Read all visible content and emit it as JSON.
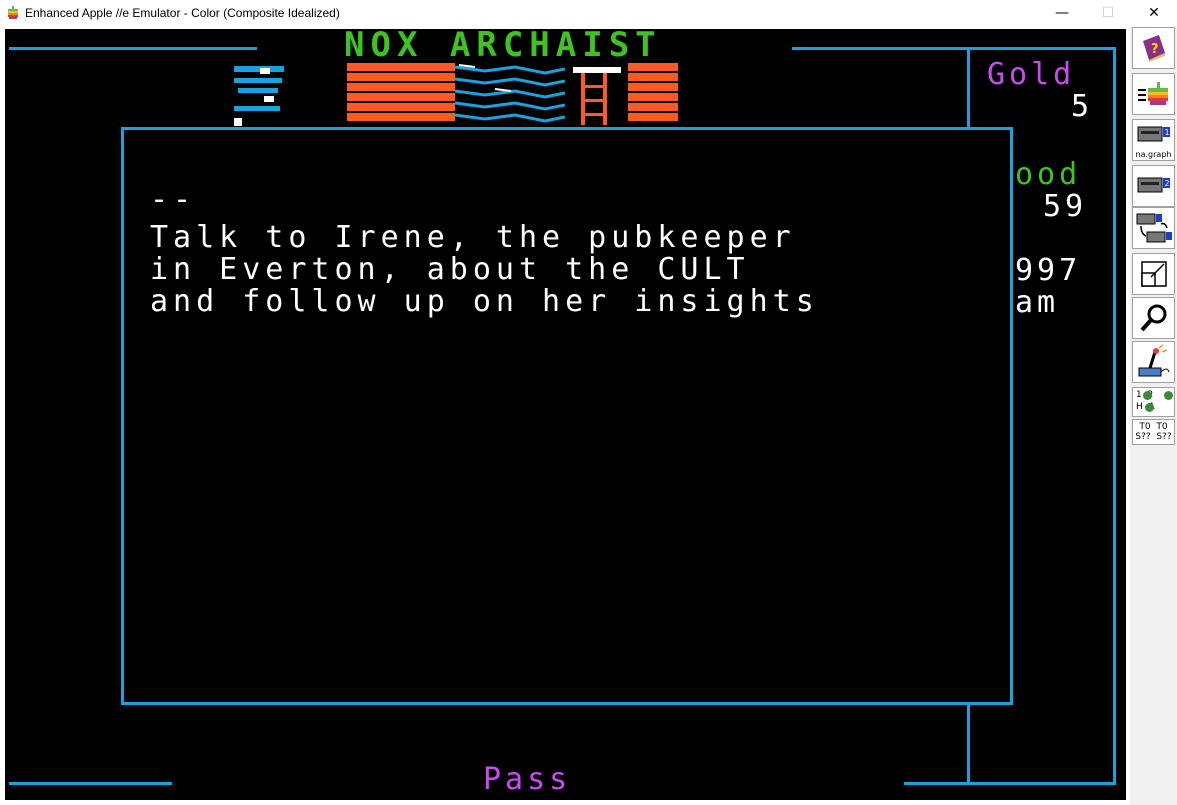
{
  "window": {
    "title": "Enhanced Apple //e Emulator - Color (Composite Idealized)",
    "minimize_label": "—",
    "maximize_label": "☐",
    "close_label": "✕"
  },
  "game": {
    "title": "NOX ARCHAIST",
    "dialog_lines": [
      "--",
      "Talk to Irene, the pubkeeper",
      "in Everton, about the CULT",
      "and follow up on her insights"
    ],
    "gold_label": "Gold",
    "gold_value": "5",
    "food_label": "ood",
    "food_value": "59",
    "stat3": "997",
    "time": "am",
    "command": "Pass"
  },
  "sidebar": {
    "disk1_label": "na.graph",
    "leds_line1": "1  2",
    "leds_line2": "H  A",
    "status_line1": "T0  T0",
    "status_line2": "S??  S??"
  },
  "colors": {
    "frame_blue": "#1aa2de",
    "title_green": "#3fc41f",
    "brick_orange": "#ff5a1f",
    "text_violet": "#c84cf0"
  },
  "icons": [
    "help-book-icon",
    "apple-run-icon",
    "disk1-icon",
    "disk2-icon",
    "swap-disks-icon",
    "fullscreen-icon",
    "debugger-magnifier-icon",
    "setup-joystick-icon"
  ]
}
